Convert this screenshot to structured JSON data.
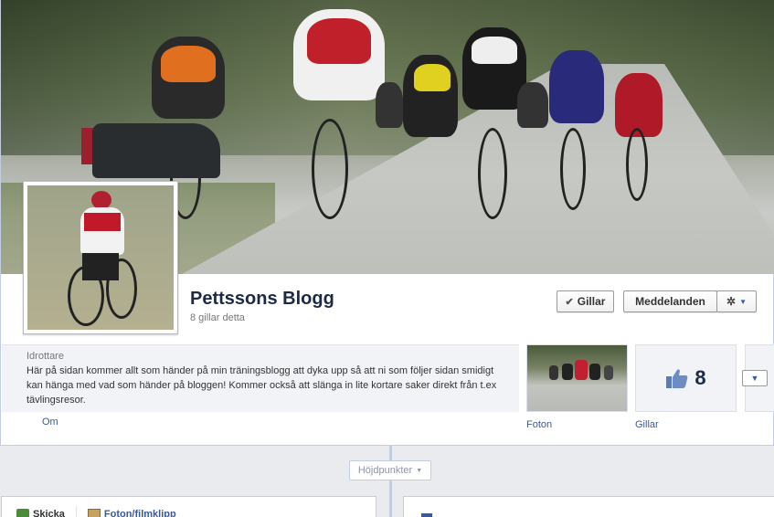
{
  "page": {
    "name": "Pettssons Blogg",
    "likes_text": "8 gillar detta"
  },
  "buttons": {
    "like_label": "Gillar",
    "message_label": "Meddelanden"
  },
  "about": {
    "category": "Idrottare",
    "text": "Här på sidan kommer allt som händer på min träningsblogg att dyka upp så att ni som följer sidan smidigt kan hänga med vad som händer på bloggen! Kommer också att slänga in lite kortare saker direkt från t.ex tävlingsresor.",
    "tab_label": "Om"
  },
  "apps": [
    {
      "label": "Foton"
    },
    {
      "label": "Gillar",
      "count": "8"
    }
  ],
  "timeline": {
    "highlights_label": "Höjdpunkter"
  },
  "composer": {
    "items": [
      "Skicka",
      "Foton/filmklipp"
    ]
  },
  "colors": {
    "fb_blue": "#3b5998",
    "page_title": "#1c2a47",
    "border": "#c4cde0"
  }
}
